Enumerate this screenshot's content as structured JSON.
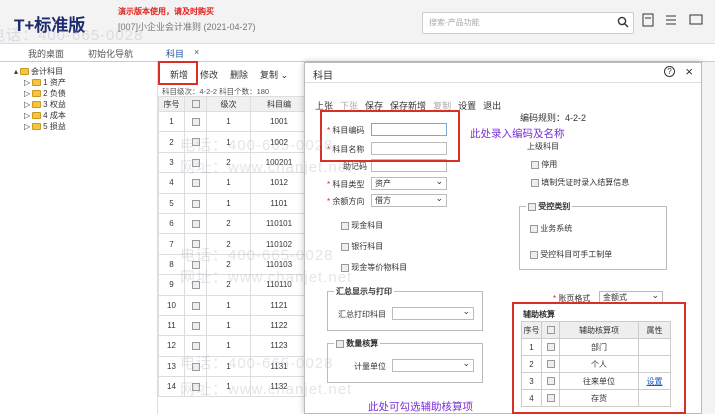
{
  "header": {
    "logo": "T+标准版",
    "demo": "演示版本使用，请及时购买",
    "account": "[007]小企业会计准则 (2021-04-27)",
    "search_placeholder": "搜索-产品功能"
  },
  "page_tabs": [
    "我的桌面",
    "初始化导航",
    "科目"
  ],
  "tree": {
    "root": "会计科目",
    "children": [
      "1 资产",
      "2 负债",
      "3 权益",
      "4 成本",
      "5 损益"
    ]
  },
  "grid": {
    "toolbar": [
      "新增",
      "修改",
      "删除",
      "复制"
    ],
    "sub": "科目级次：4-2-2  科目个数：180",
    "headers": [
      "序号",
      "",
      "级次",
      "科目编"
    ],
    "rows": [
      [
        "1",
        "1",
        "1001"
      ],
      [
        "2",
        "1",
        "1002"
      ],
      [
        "3",
        "2",
        "100201"
      ],
      [
        "4",
        "1",
        "1012"
      ],
      [
        "5",
        "1",
        "1101"
      ],
      [
        "6",
        "2",
        "110101"
      ],
      [
        "7",
        "2",
        "110102"
      ],
      [
        "8",
        "2",
        "110103"
      ],
      [
        "9",
        "2",
        "110110"
      ],
      [
        "10",
        "1",
        "1121"
      ],
      [
        "11",
        "1",
        "1122"
      ],
      [
        "12",
        "1",
        "1123"
      ],
      [
        "13",
        "1",
        "1131"
      ],
      [
        "14",
        "1",
        "1132"
      ]
    ]
  },
  "modal": {
    "title": "科目",
    "toolbar": [
      "上张",
      "下张",
      "保存",
      "保存新增",
      "复制",
      "设置",
      "退出"
    ],
    "code_rule_label": "编码规则",
    "code_rule": "4-2-2",
    "parent_label": "上级科目",
    "code_label": "科目编码",
    "name_label": "科目名称",
    "mnemonic_label": "助记码",
    "type_label": "科目类型",
    "type_value": "资产",
    "direction_label": "余额方向",
    "direction_value": "借方",
    "cash": "现金科目",
    "bank": "银行科目",
    "cash_eq": "现金等价物科目",
    "disable": "停用",
    "fill_cert": "填制凭证时录入结算信息",
    "controlled_group": "受控类别",
    "biz_system": "业务系统",
    "ctrl_manual": "受控科目可手工制单",
    "display_group": "汇总显示与打印",
    "display_label": "汇总打印科目",
    "qty_group": "数量核算",
    "unit_label": "计量单位",
    "format_label": "账页格式",
    "format_value": "金额式",
    "aux_group": "辅助核算",
    "aux_headers": [
      "序号",
      "",
      "辅助核算项",
      "属性"
    ],
    "aux_rows": [
      [
        "1",
        "部门",
        ""
      ],
      [
        "2",
        "个人",
        ""
      ],
      [
        "3",
        "往来单位",
        "设置"
      ],
      [
        "4",
        "存货",
        ""
      ]
    ]
  },
  "annotations": {
    "name_hint": "此处录入编码及名称",
    "aux_hint": "此处可勾选辅助核算项"
  },
  "watermark": {
    "phone": "电话：400-665-0028",
    "url": "网址：www.chanjet.net"
  },
  "colors": {
    "annotation": "#7a2fd6",
    "highlight": "#d93025",
    "demo": "#e0201c"
  }
}
